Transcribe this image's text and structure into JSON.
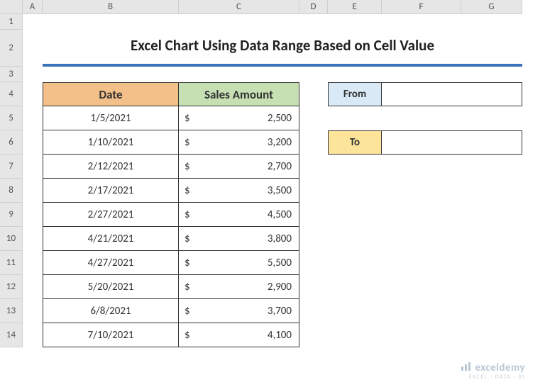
{
  "cols": [
    "A",
    "B",
    "C",
    "D",
    "E",
    "F",
    "G"
  ],
  "rows": [
    "1",
    "2",
    "3",
    "4",
    "5",
    "6",
    "7",
    "8",
    "9",
    "10",
    "11",
    "12",
    "13",
    "14"
  ],
  "title": "Excel Chart Using Data Range Based on Cell Value",
  "headers": {
    "date": "Date",
    "sales": "Sales Amount"
  },
  "currency": "$",
  "data": [
    {
      "date": "1/5/2021",
      "amount": "2,500"
    },
    {
      "date": "1/10/2021",
      "amount": "3,200"
    },
    {
      "date": "2/12/2021",
      "amount": "2,700"
    },
    {
      "date": "2/17/2021",
      "amount": "3,500"
    },
    {
      "date": "2/27/2021",
      "amount": "4,500"
    },
    {
      "date": "4/21/2021",
      "amount": "3,800"
    },
    {
      "date": "4/27/2021",
      "amount": "5,500"
    },
    {
      "date": "5/20/2021",
      "amount": "2,900"
    },
    {
      "date": "6/8/2021",
      "amount": "3,700"
    },
    {
      "date": "7/10/2021",
      "amount": "4,100"
    }
  ],
  "filter": {
    "from_label": "From",
    "from_value": "",
    "to_label": "To",
    "to_value": ""
  },
  "watermark": {
    "brand": "exceldemy",
    "sub": "EXCEL · DATA · BI"
  }
}
